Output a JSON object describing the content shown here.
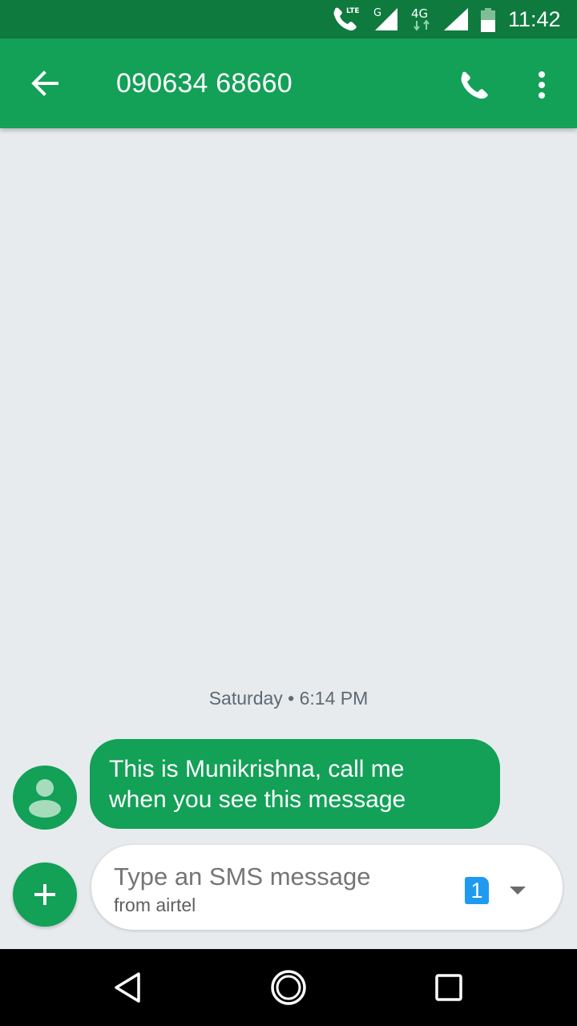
{
  "status_bar": {
    "time": "11:42",
    "icons": [
      "call-lte-icon",
      "signal-g-icon",
      "data-4g-icon",
      "signal-icon",
      "battery-icon"
    ],
    "lte_label": "LTE",
    "g_label": "G",
    "fourg_label": "4G"
  },
  "app_bar": {
    "title": "090634 68660",
    "back_icon": "arrow-back-icon",
    "call_icon": "phone-icon",
    "more_icon": "more-vert-icon"
  },
  "conversation": {
    "date_separator": "Saturday • 6:14 PM",
    "messages": [
      {
        "text_line1": "This is Munikrishna, call me",
        "text_line2": "when you see this message"
      }
    ]
  },
  "composer": {
    "placeholder": "Type an SMS message",
    "subtext": "from airtel",
    "sim_number": "1"
  },
  "colors": {
    "status_bar": "#0e7a3e",
    "app_bar": "#13a057",
    "background": "#e8ebee",
    "sim_badge": "#1e9bf0"
  }
}
